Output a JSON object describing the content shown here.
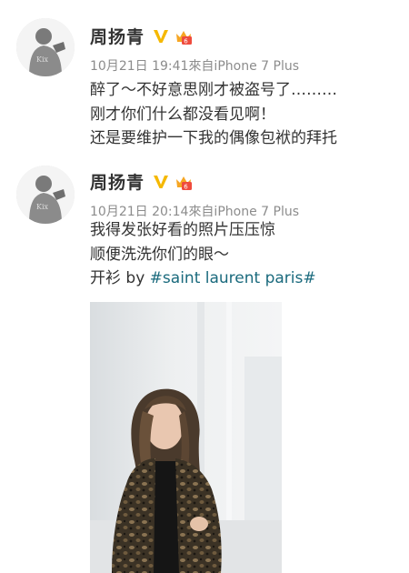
{
  "posts": [
    {
      "username": "周扬青",
      "verified_icon": "yellow-v-badge-icon",
      "level_icon": "member-level-badge-icon",
      "time": "10月21日 19:41",
      "source": "來自iPhone 7 Plus",
      "lines": [
        "醉了～不好意思刚才被盗号了………",
        "刚才你们什么都没看见啊！",
        "还是要维护一下我的偶像包袱的拜托"
      ]
    },
    {
      "username": "周扬青",
      "verified_icon": "yellow-v-badge-icon",
      "level_icon": "member-level-badge-icon",
      "time": "10月21日 20:14",
      "source": "來自iPhone 7 Plus",
      "lines": [
        "我得发张好看的照片压压惊",
        "顺便洗洗你们的眼～"
      ],
      "caption_prefix": "开衫 by ",
      "caption_topic": "#saint laurent paris#",
      "photo": "woman-in-patterned-cardigan-photo"
    }
  ],
  "colors": {
    "text": "#333333",
    "meta": "#8c8c8c",
    "topic": "#1a6a7d",
    "verified": "#f5b800"
  }
}
